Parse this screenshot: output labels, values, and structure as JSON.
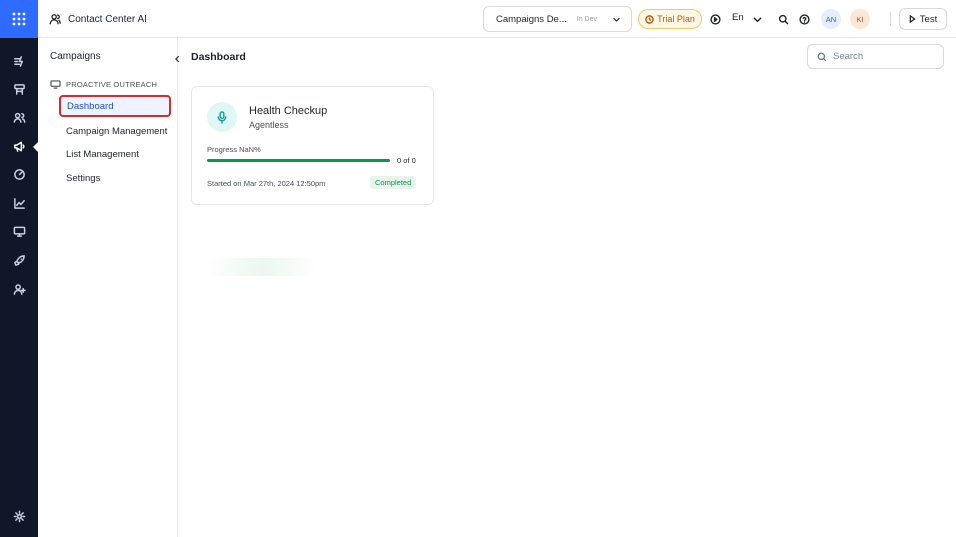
{
  "app": {
    "title": "Contact Center AI",
    "selected_app": "Campaigns De...",
    "environment": "In Dev",
    "trial_label": "Trial Plan",
    "language": "En",
    "avatars": [
      "AN",
      "KI"
    ],
    "test_label": "Test"
  },
  "rail": {
    "icons": [
      "apps-grid-icon",
      "automation-icon",
      "flows-icon",
      "contacts-icon",
      "campaigns-icon",
      "speed-icon",
      "analytics-icon",
      "monitor-icon",
      "deploy-icon",
      "user-add-icon",
      "settings-icon"
    ],
    "active": "campaigns-icon"
  },
  "sidebar": {
    "title": "Campaigns",
    "group": "PROACTIVE OUTREACH",
    "items": [
      {
        "label": "Dashboard",
        "active": true
      },
      {
        "label": "Campaign Management",
        "active": false
      },
      {
        "label": "List Management",
        "active": false
      },
      {
        "label": "Settings",
        "active": false
      }
    ]
  },
  "main": {
    "title": "Dashboard",
    "search_placeholder": "Search",
    "card": {
      "title": "Health Checkup",
      "subtitle": "Agentless",
      "progress_label": "Progress NaN%",
      "progress_fraction": 1.0,
      "progress_count": "0 of 0",
      "started": "Started on Mar 27th, 2024 12:50pm",
      "status": "Completed"
    }
  },
  "colors": {
    "rail_bg": "#0f1729",
    "logo_bg": "#2f6bff",
    "active_nav": "#1c4fd6",
    "highlight_border": "#d92b2b",
    "progress": "#15924b",
    "trial": "#b25e09"
  }
}
